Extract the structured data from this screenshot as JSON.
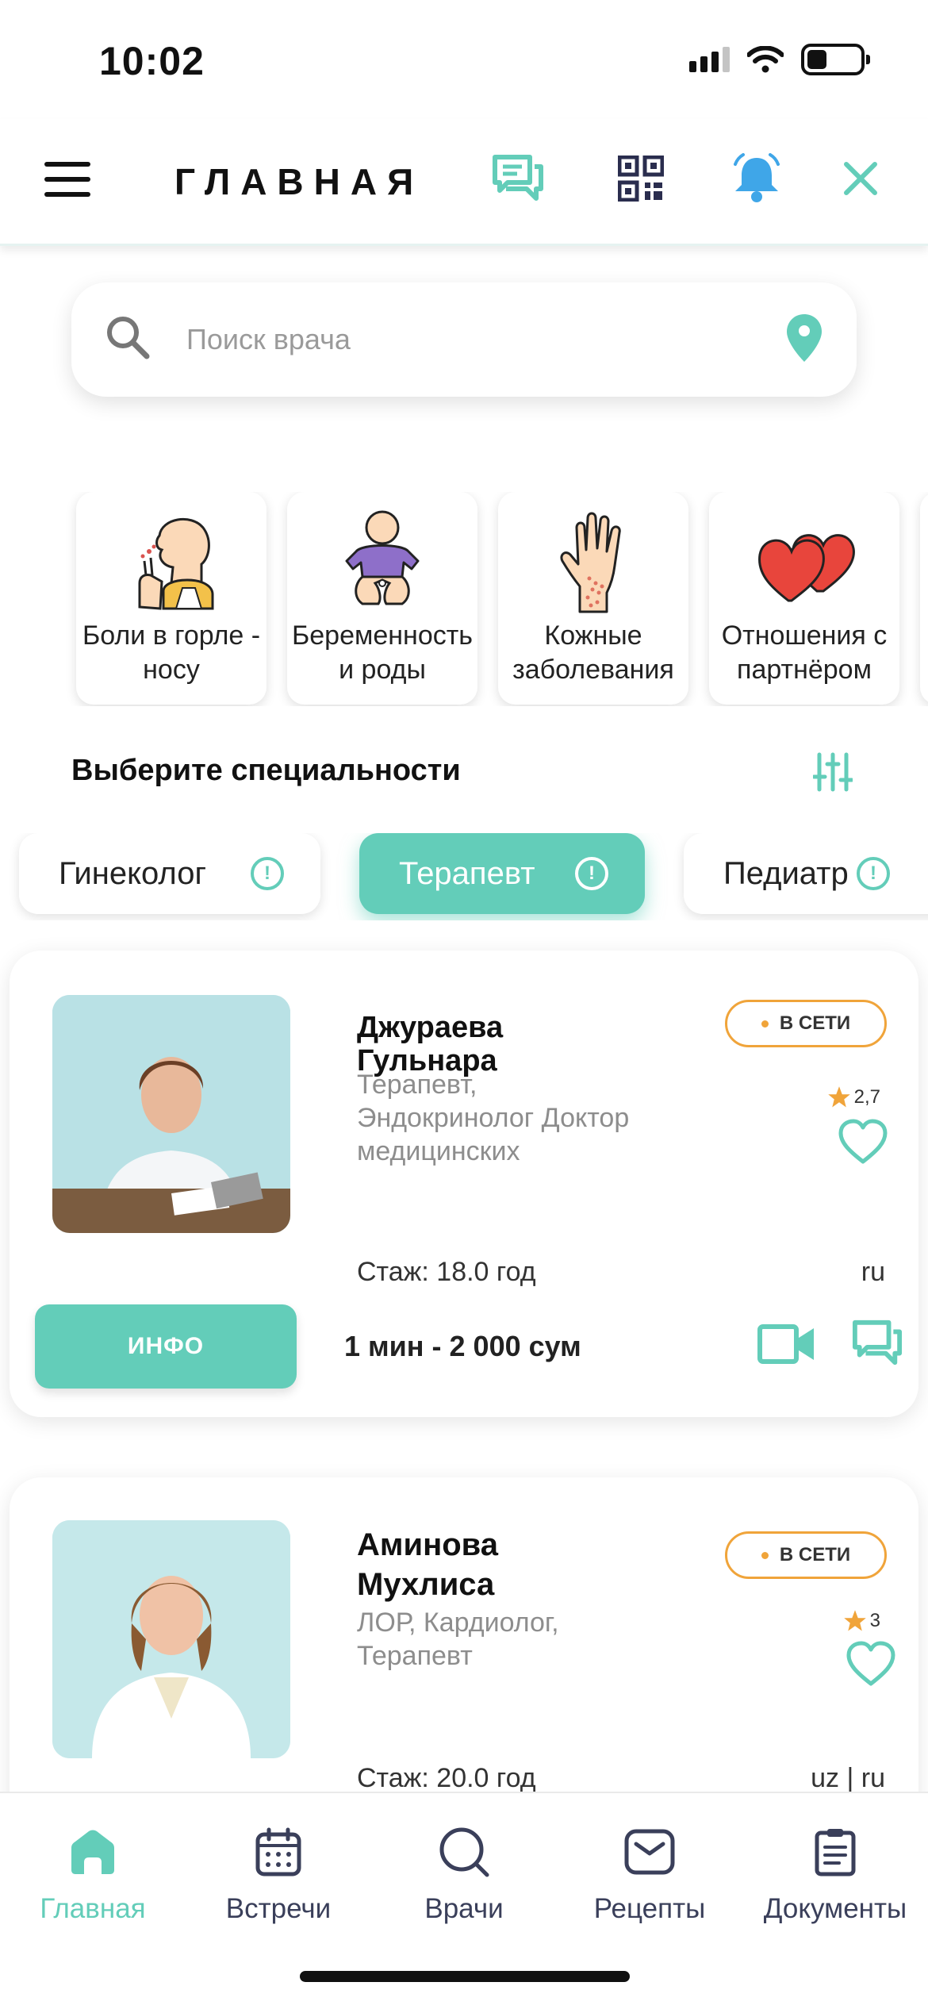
{
  "status_bar": {
    "time": "10:02"
  },
  "header": {
    "title": "ГЛАВНАЯ"
  },
  "search": {
    "placeholder": "Поиск врача"
  },
  "categories": [
    {
      "label": "Боли в горле - носу",
      "icon": "sore-throat-icon"
    },
    {
      "label": "Беременность и роды",
      "icon": "baby-icon"
    },
    {
      "label": "Кожные заболевания",
      "icon": "hand-rash-icon"
    },
    {
      "label": "Отношения с партнёром",
      "icon": "hearts-icon"
    }
  ],
  "specialties": {
    "title": "Выберите специальности",
    "chips": [
      {
        "label": "Гинеколог",
        "active": false
      },
      {
        "label": "Терапевт",
        "active": true
      },
      {
        "label": "Педиатр",
        "active": false
      }
    ]
  },
  "doctors": [
    {
      "name": "Джураева Гульнара",
      "specialty": "Терапевт, Эндокринолог Доктор медицинских",
      "status": "В СЕТИ",
      "rating": "2,7",
      "experience": "Стаж: 18.0 год",
      "languages": "ru",
      "info_label": "ИНФО",
      "price": "1 мин - 2 000 сум"
    },
    {
      "name": "Аминова Мухлиса",
      "specialty": "ЛОР, Кардиолог, Терапевт",
      "status": "В СЕТИ",
      "rating": "3",
      "experience": "Стаж: 20.0 год",
      "languages": "uz | ru"
    }
  ],
  "bottom_nav": [
    {
      "label": "Главная",
      "icon": "home-icon",
      "active": true
    },
    {
      "label": "Встречи",
      "icon": "calendar-icon",
      "active": false
    },
    {
      "label": "Врачи",
      "icon": "search-icon",
      "active": false
    },
    {
      "label": "Рецепты",
      "icon": "prescription-icon",
      "active": false
    },
    {
      "label": "Документы",
      "icon": "document-icon",
      "active": false
    }
  ],
  "colors": {
    "accent": "#63cdb9",
    "badge": "#f0a43a",
    "bell": "#3fa6e8",
    "qr": "#2a2d4e",
    "star": "#f0a43a"
  }
}
